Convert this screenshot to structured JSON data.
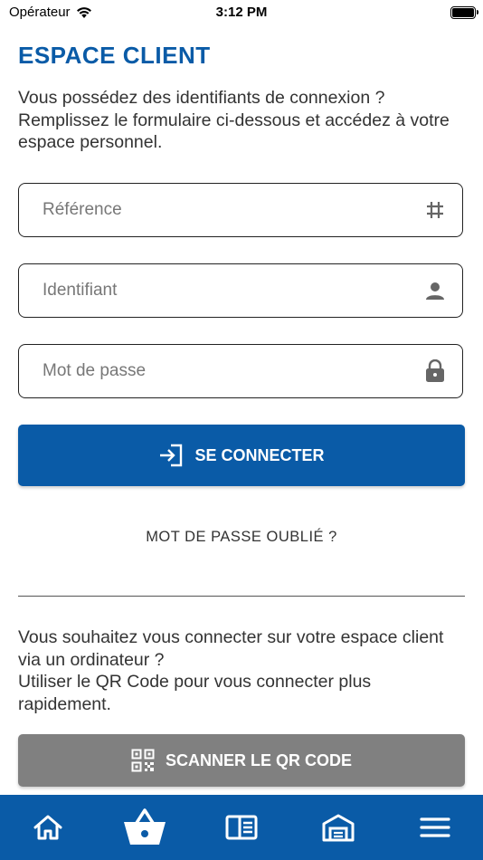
{
  "status_bar": {
    "carrier": "Opérateur",
    "time": "3:12 PM"
  },
  "page": {
    "title": "ESPACE CLIENT",
    "intro": "Vous possédez des identifiants de connexion ? Remplissez le formulaire ci-dessous et accédez à votre espace personnel."
  },
  "form": {
    "reference_placeholder": "Référence",
    "identifiant_placeholder": "Identifiant",
    "password_placeholder": "Mot de passe",
    "reference_value": "",
    "identifiant_value": "",
    "password_value": "",
    "connect_label": "SE CONNECTER",
    "forgot_label": "MOT DE PASSE OUBLIÉ ?"
  },
  "qr": {
    "text_line1": "Vous souhaitez vous connecter sur votre espace client via un ordinateur ?",
    "text_line2": "Utiliser le QR Code pour vous connecter plus rapidement.",
    "button_label": "SCANNER LE QR CODE"
  },
  "tabbar": {
    "icons": [
      "home-icon",
      "basket-icon",
      "catalog-icon",
      "store-icon",
      "menu-icon"
    ],
    "active_index": 1
  },
  "colors": {
    "primary": "#0a5ba7",
    "secondary_button": "#808080"
  }
}
